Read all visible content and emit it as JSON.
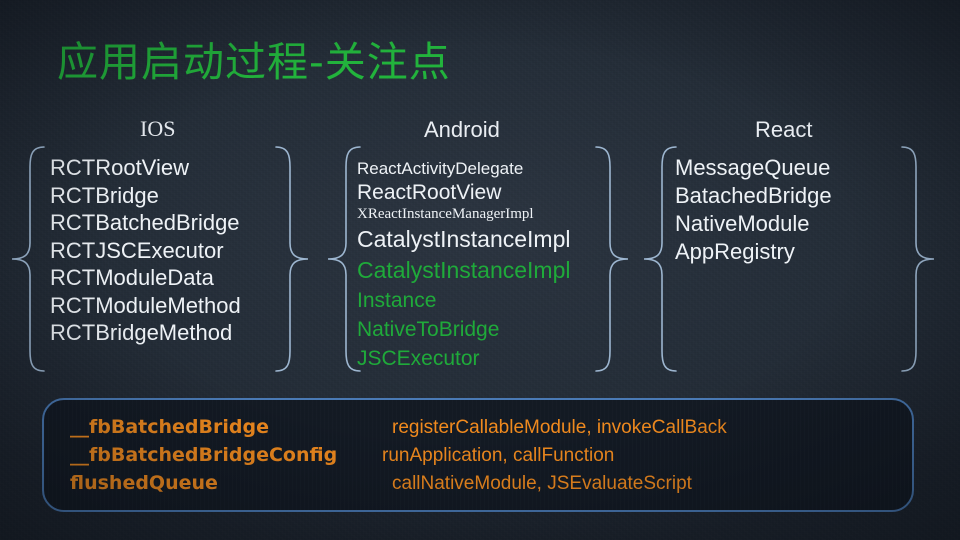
{
  "slide": {
    "title": "应用启动过程-关注点",
    "title_color": "#22b33c",
    "background_color": "#262f3a",
    "accent_green": "#1faa3a",
    "accent_orange": "#f08a1e",
    "brace_color": "#9db6d0",
    "panel_border_color": "#4a7ab5",
    "panel_fill_color": "#131a24"
  },
  "columns": [
    {
      "header": "IOS",
      "items": [
        {
          "text": "RCTRootView",
          "color": "white",
          "size": "md"
        },
        {
          "text": "RCTBridge",
          "color": "white",
          "size": "md"
        },
        {
          "text": "RCTBatchedBridge",
          "color": "white",
          "size": "md"
        },
        {
          "text": "RCTJSCExecutor",
          "color": "white",
          "size": "md"
        },
        {
          "text": "RCTModuleData",
          "color": "white",
          "size": "md"
        },
        {
          "text": "RCTModuleMethod",
          "color": "white",
          "size": "md"
        },
        {
          "text": "RCTBridgeMethod",
          "color": "white",
          "size": "md"
        }
      ]
    },
    {
      "header": "Android",
      "items": [
        {
          "text": "ReactActivityDelegate",
          "color": "white",
          "size": "sm"
        },
        {
          "text": "ReactRootView",
          "color": "white",
          "size": "md"
        },
        {
          "text": "XReactInstanceManagerImpl",
          "color": "white",
          "size": "xs"
        },
        {
          "text": "CatalystInstanceImpl",
          "color": "white",
          "size": "lg"
        },
        {
          "text": "CatalystInstanceImpl",
          "color": "green",
          "size": "lg"
        },
        {
          "text": "Instance",
          "color": "green",
          "size": "md"
        },
        {
          "text": "NativeToBridge",
          "color": "green",
          "size": "md"
        },
        {
          "text": "JSCExecutor",
          "color": "green",
          "size": "md"
        }
      ]
    },
    {
      "header": "React",
      "items": [
        {
          "text": "MessageQueue",
          "color": "white",
          "size": "md"
        },
        {
          "text": "BatachedBridge",
          "color": "white",
          "size": "md"
        },
        {
          "text": "NativeModule",
          "color": "white",
          "size": "md"
        },
        {
          "text": "AppRegistry",
          "color": "white",
          "size": "md"
        }
      ]
    }
  ],
  "panel": {
    "rows": [
      {
        "name": "__fbBatchedBridge",
        "methods": "registerCallableModule, invokeCallBack"
      },
      {
        "name": "__fbBatchedBridgeConfig",
        "methods": "runApplication, callFunction"
      },
      {
        "name": "flushedQueue",
        "methods": "callNativeModule, JSEvaluateScript"
      }
    ]
  }
}
